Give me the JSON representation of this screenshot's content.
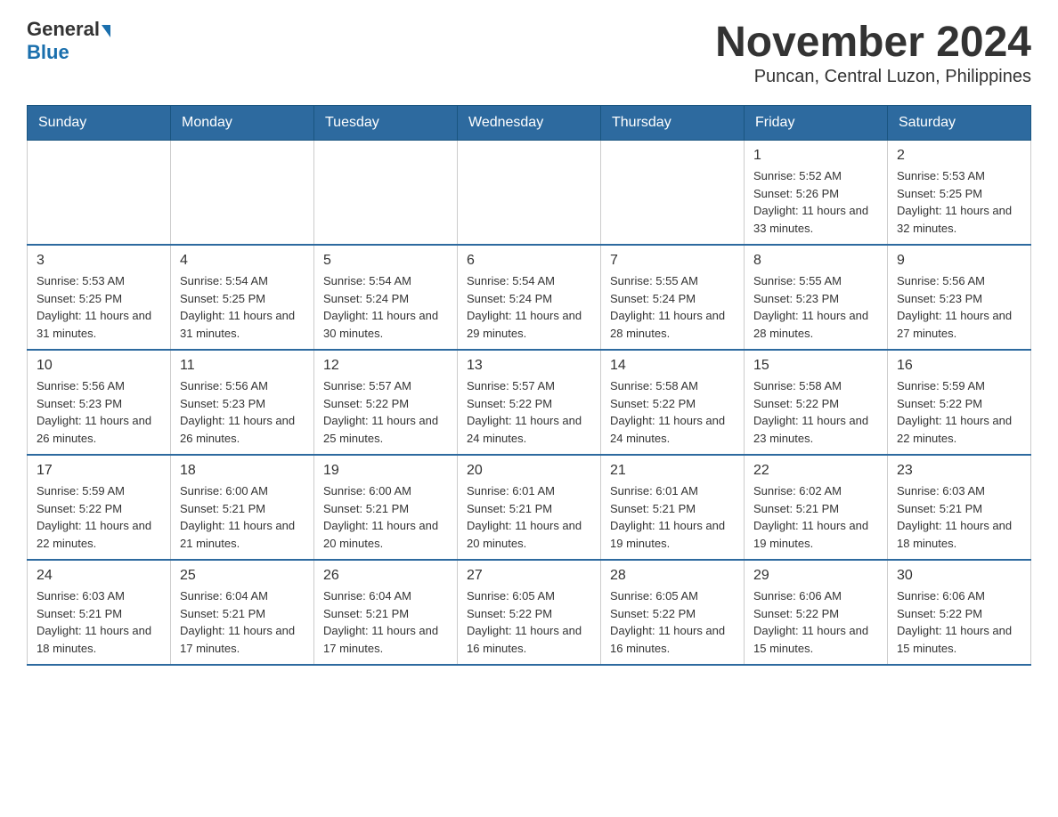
{
  "header": {
    "logo_general": "General",
    "logo_blue": "Blue",
    "month_title": "November 2024",
    "location": "Puncan, Central Luzon, Philippines"
  },
  "weekdays": [
    "Sunday",
    "Monday",
    "Tuesday",
    "Wednesday",
    "Thursday",
    "Friday",
    "Saturday"
  ],
  "weeks": [
    [
      {
        "day": "",
        "info": ""
      },
      {
        "day": "",
        "info": ""
      },
      {
        "day": "",
        "info": ""
      },
      {
        "day": "",
        "info": ""
      },
      {
        "day": "",
        "info": ""
      },
      {
        "day": "1",
        "info": "Sunrise: 5:52 AM\nSunset: 5:26 PM\nDaylight: 11 hours and 33 minutes."
      },
      {
        "day": "2",
        "info": "Sunrise: 5:53 AM\nSunset: 5:25 PM\nDaylight: 11 hours and 32 minutes."
      }
    ],
    [
      {
        "day": "3",
        "info": "Sunrise: 5:53 AM\nSunset: 5:25 PM\nDaylight: 11 hours and 31 minutes."
      },
      {
        "day": "4",
        "info": "Sunrise: 5:54 AM\nSunset: 5:25 PM\nDaylight: 11 hours and 31 minutes."
      },
      {
        "day": "5",
        "info": "Sunrise: 5:54 AM\nSunset: 5:24 PM\nDaylight: 11 hours and 30 minutes."
      },
      {
        "day": "6",
        "info": "Sunrise: 5:54 AM\nSunset: 5:24 PM\nDaylight: 11 hours and 29 minutes."
      },
      {
        "day": "7",
        "info": "Sunrise: 5:55 AM\nSunset: 5:24 PM\nDaylight: 11 hours and 28 minutes."
      },
      {
        "day": "8",
        "info": "Sunrise: 5:55 AM\nSunset: 5:23 PM\nDaylight: 11 hours and 28 minutes."
      },
      {
        "day": "9",
        "info": "Sunrise: 5:56 AM\nSunset: 5:23 PM\nDaylight: 11 hours and 27 minutes."
      }
    ],
    [
      {
        "day": "10",
        "info": "Sunrise: 5:56 AM\nSunset: 5:23 PM\nDaylight: 11 hours and 26 minutes."
      },
      {
        "day": "11",
        "info": "Sunrise: 5:56 AM\nSunset: 5:23 PM\nDaylight: 11 hours and 26 minutes."
      },
      {
        "day": "12",
        "info": "Sunrise: 5:57 AM\nSunset: 5:22 PM\nDaylight: 11 hours and 25 minutes."
      },
      {
        "day": "13",
        "info": "Sunrise: 5:57 AM\nSunset: 5:22 PM\nDaylight: 11 hours and 24 minutes."
      },
      {
        "day": "14",
        "info": "Sunrise: 5:58 AM\nSunset: 5:22 PM\nDaylight: 11 hours and 24 minutes."
      },
      {
        "day": "15",
        "info": "Sunrise: 5:58 AM\nSunset: 5:22 PM\nDaylight: 11 hours and 23 minutes."
      },
      {
        "day": "16",
        "info": "Sunrise: 5:59 AM\nSunset: 5:22 PM\nDaylight: 11 hours and 22 minutes."
      }
    ],
    [
      {
        "day": "17",
        "info": "Sunrise: 5:59 AM\nSunset: 5:22 PM\nDaylight: 11 hours and 22 minutes."
      },
      {
        "day": "18",
        "info": "Sunrise: 6:00 AM\nSunset: 5:21 PM\nDaylight: 11 hours and 21 minutes."
      },
      {
        "day": "19",
        "info": "Sunrise: 6:00 AM\nSunset: 5:21 PM\nDaylight: 11 hours and 20 minutes."
      },
      {
        "day": "20",
        "info": "Sunrise: 6:01 AM\nSunset: 5:21 PM\nDaylight: 11 hours and 20 minutes."
      },
      {
        "day": "21",
        "info": "Sunrise: 6:01 AM\nSunset: 5:21 PM\nDaylight: 11 hours and 19 minutes."
      },
      {
        "day": "22",
        "info": "Sunrise: 6:02 AM\nSunset: 5:21 PM\nDaylight: 11 hours and 19 minutes."
      },
      {
        "day": "23",
        "info": "Sunrise: 6:03 AM\nSunset: 5:21 PM\nDaylight: 11 hours and 18 minutes."
      }
    ],
    [
      {
        "day": "24",
        "info": "Sunrise: 6:03 AM\nSunset: 5:21 PM\nDaylight: 11 hours and 18 minutes."
      },
      {
        "day": "25",
        "info": "Sunrise: 6:04 AM\nSunset: 5:21 PM\nDaylight: 11 hours and 17 minutes."
      },
      {
        "day": "26",
        "info": "Sunrise: 6:04 AM\nSunset: 5:21 PM\nDaylight: 11 hours and 17 minutes."
      },
      {
        "day": "27",
        "info": "Sunrise: 6:05 AM\nSunset: 5:22 PM\nDaylight: 11 hours and 16 minutes."
      },
      {
        "day": "28",
        "info": "Sunrise: 6:05 AM\nSunset: 5:22 PM\nDaylight: 11 hours and 16 minutes."
      },
      {
        "day": "29",
        "info": "Sunrise: 6:06 AM\nSunset: 5:22 PM\nDaylight: 11 hours and 15 minutes."
      },
      {
        "day": "30",
        "info": "Sunrise: 6:06 AM\nSunset: 5:22 PM\nDaylight: 11 hours and 15 minutes."
      }
    ]
  ]
}
